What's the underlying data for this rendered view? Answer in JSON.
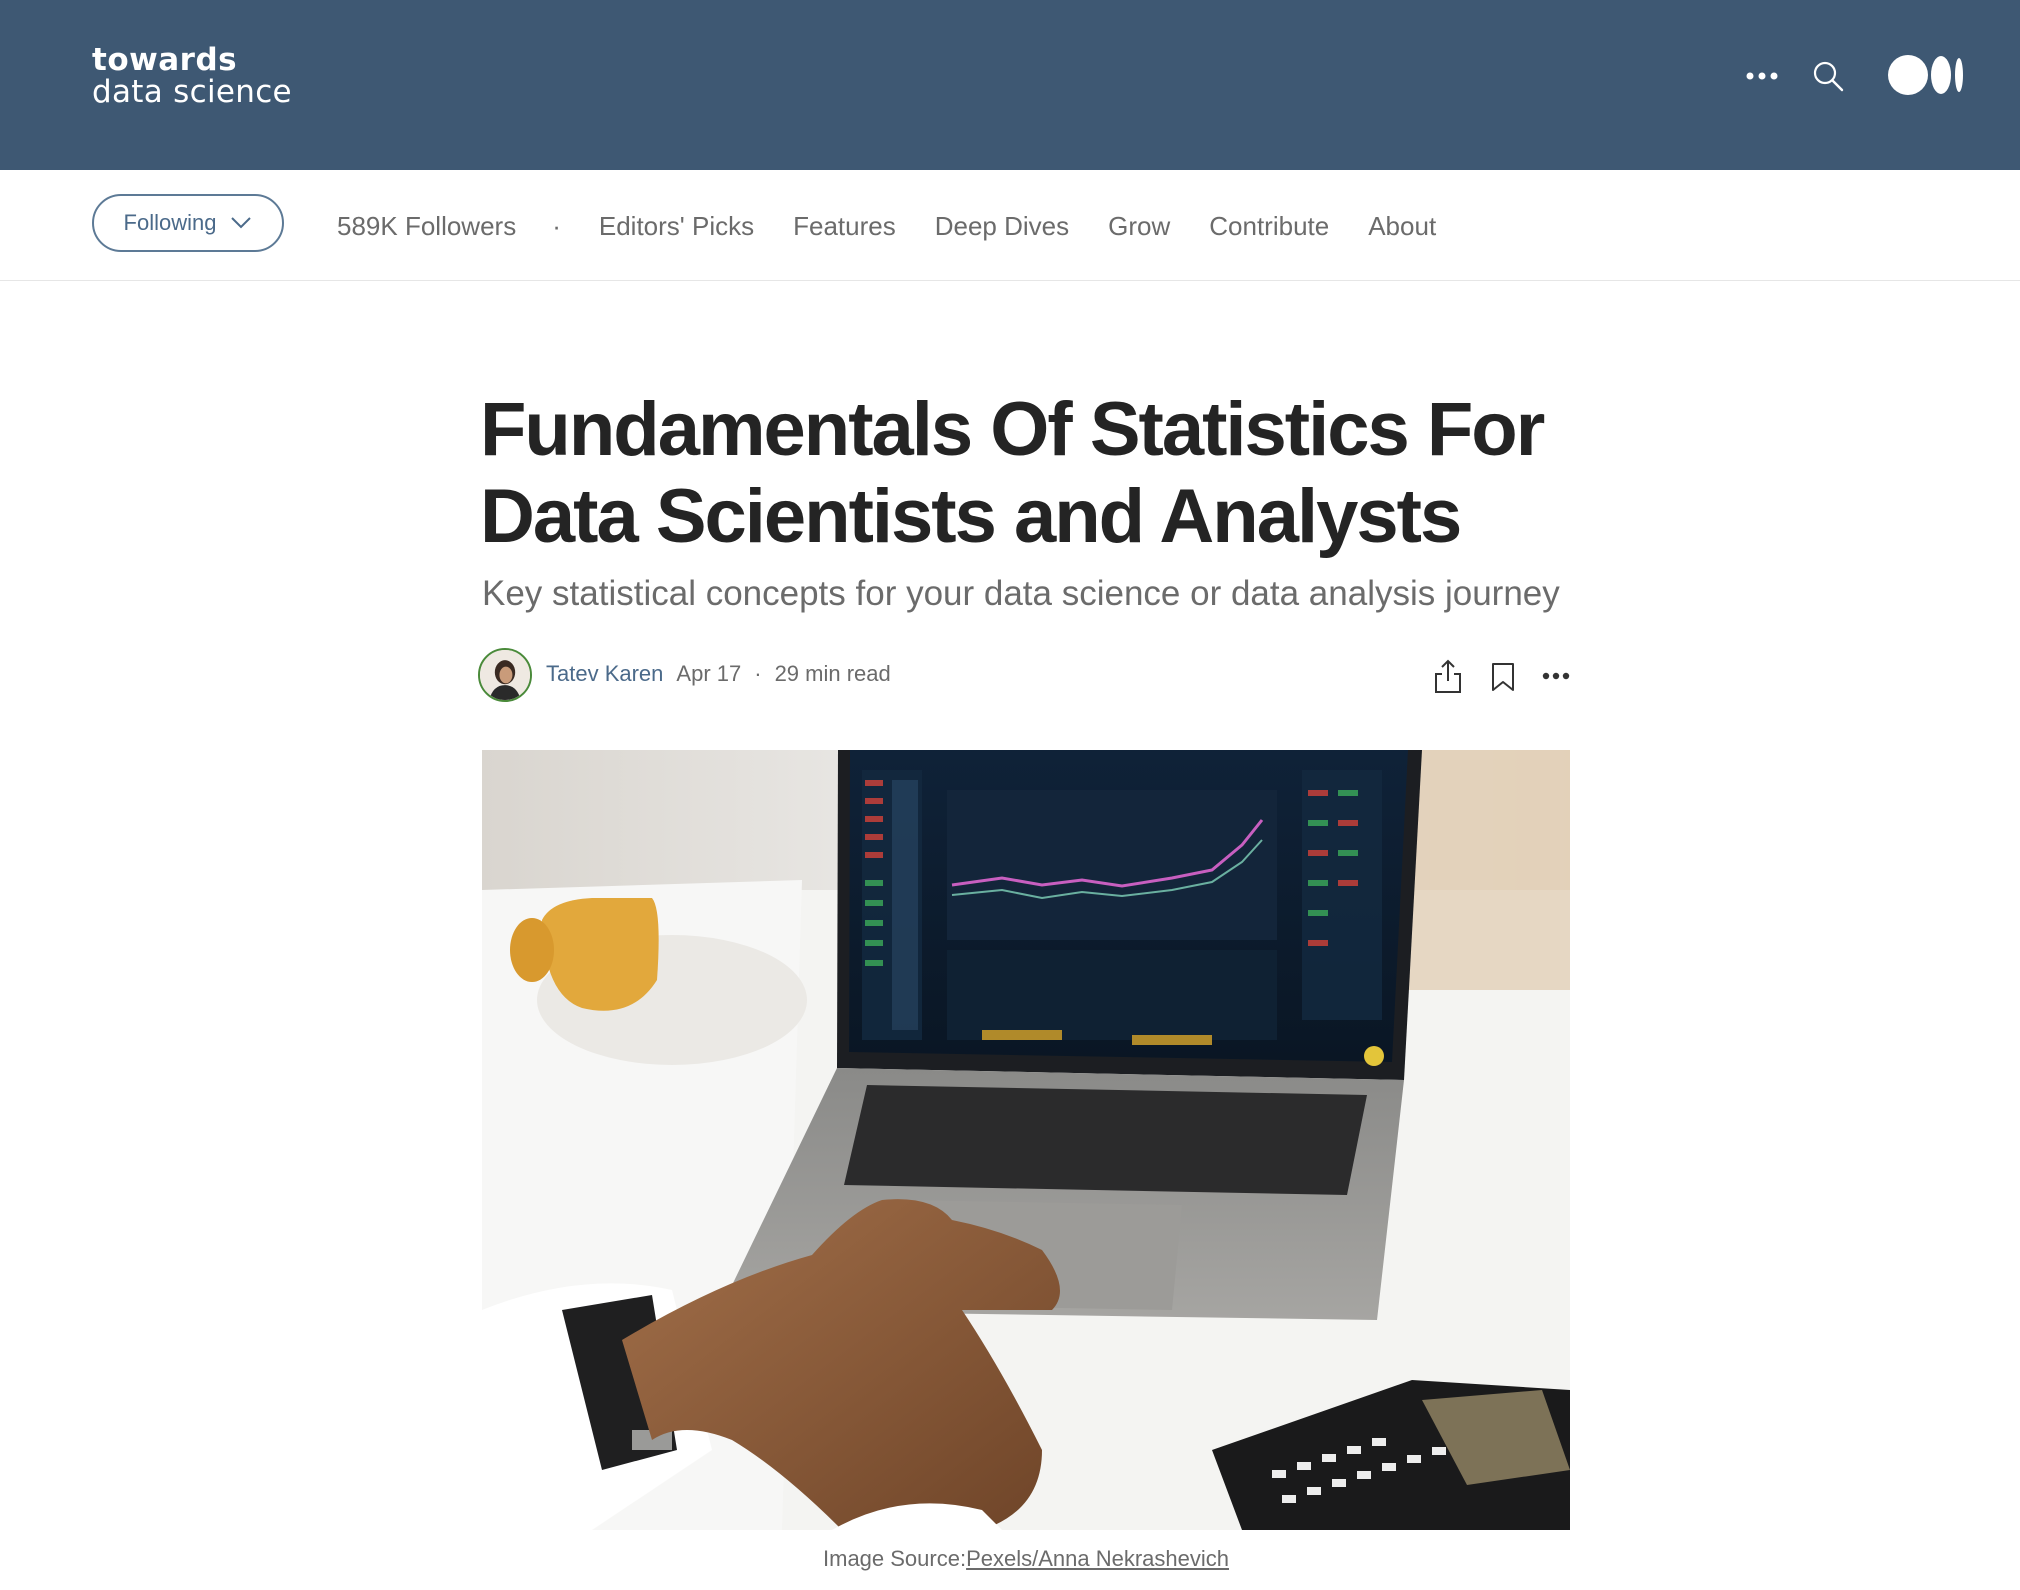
{
  "header": {
    "logo_line1": "towards",
    "logo_line2": "data science",
    "bg_color": "#3e5873",
    "icons": [
      "more-icon",
      "search-icon",
      "medium-logo"
    ]
  },
  "subnav": {
    "follow_button": "Following",
    "followers": "589K Followers",
    "separator": "·",
    "links": [
      "Editors' Picks",
      "Features",
      "Deep Dives",
      "Grow",
      "Contribute",
      "About"
    ]
  },
  "article": {
    "title": "Fundamentals Of Statistics For Data Scientists and Analysts",
    "subtitle": "Key statistical concepts for your data science or data analysis journey",
    "author": "Tatev Karen",
    "date": "Apr 17",
    "dot": "·",
    "read_time": "29 min read",
    "image_caption_prefix": "Image Source:",
    "image_caption_link": "Pexels/Anna Nekrashevich",
    "accent_color": "#4b6a8a"
  }
}
